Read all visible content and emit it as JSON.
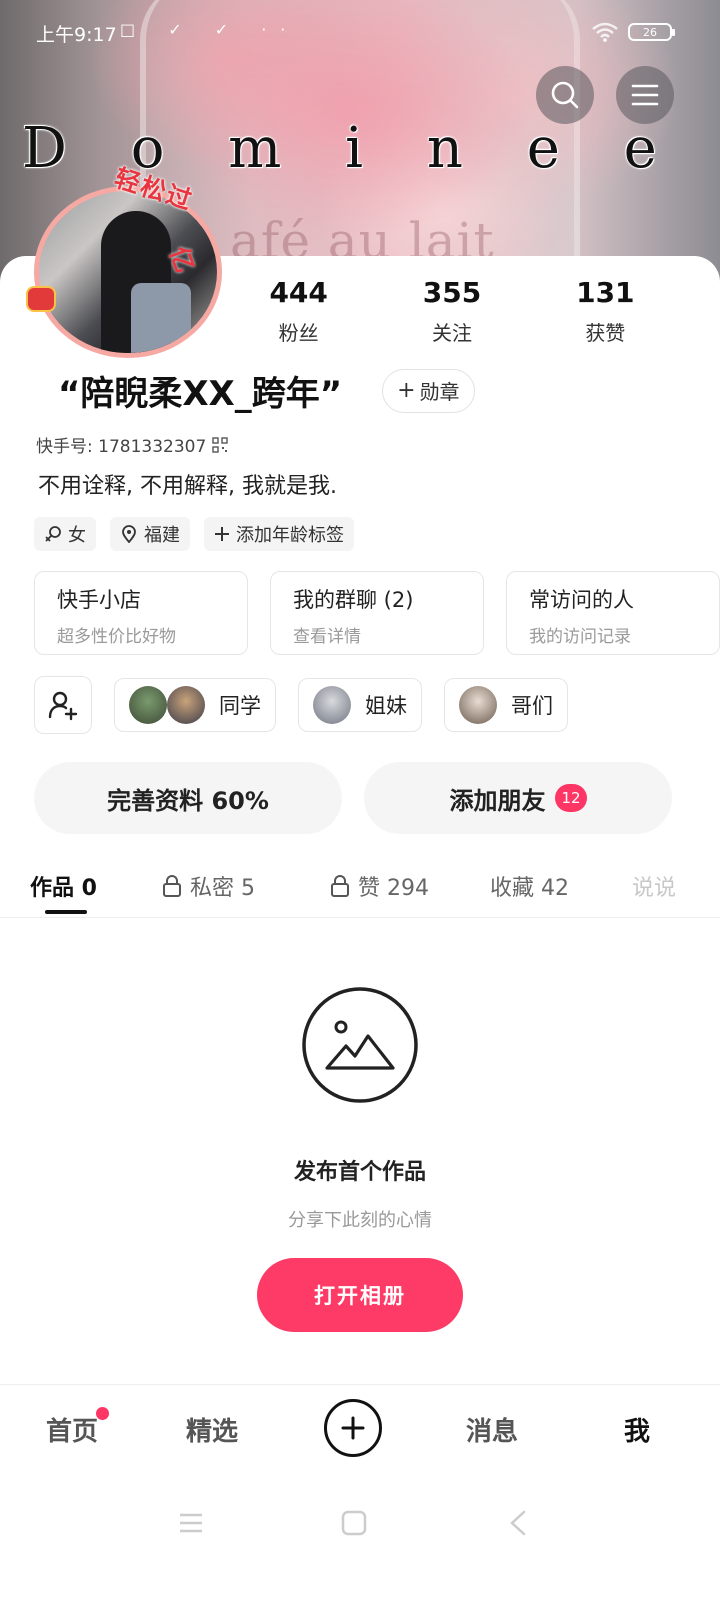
{
  "status_bar": {
    "time": "上午9:17",
    "notification_icons": "□ ✓ ✓ ··",
    "battery": "26"
  },
  "cover": {
    "title": "D o m i n e e r i n g",
    "watermark": "afé au lait"
  },
  "avatar": {
    "badge_text": "轻松过",
    "badge_text2": "亿"
  },
  "stats": [
    {
      "value": "444",
      "label": "粉丝"
    },
    {
      "value": "355",
      "label": "关注"
    },
    {
      "value": "131",
      "label": "获赞"
    }
  ],
  "profile": {
    "name": "“陪睨柔XX_跨年”",
    "medal_label": "勋章",
    "id_label": "快手号: 1781332307",
    "bio": "不用诠释, 不用解释, 我就是我."
  },
  "tags": [
    {
      "icon": "female-icon",
      "label": "女"
    },
    {
      "icon": "location-icon",
      "label": "福建"
    },
    {
      "icon": "plus-icon",
      "label": "添加年龄标签"
    }
  ],
  "boxes": [
    {
      "title": "快手小店",
      "sub": "超多性价比好物"
    },
    {
      "title": "我的群聊 (2)",
      "sub": "查看详情"
    },
    {
      "title": "常访问的人",
      "sub": "我的访问记录"
    }
  ],
  "groups": [
    {
      "label": "同学"
    },
    {
      "label": "姐妹"
    },
    {
      "label": "哥们"
    }
  ],
  "actions": {
    "complete_profile": "完善资料 60%",
    "add_friends": "添加朋友",
    "add_friends_badge": "12"
  },
  "tabs": [
    {
      "label": "作品 0",
      "locked": false,
      "active": true
    },
    {
      "label": "私密 5",
      "locked": true,
      "active": false
    },
    {
      "label": "赞 294",
      "locked": true,
      "active": false
    },
    {
      "label": "收藏 42",
      "locked": false,
      "active": false
    },
    {
      "label": "说说",
      "locked": false,
      "active": false
    }
  ],
  "empty_state": {
    "title": "发布首个作品",
    "subtitle": "分享下此刻的心情",
    "button": "打开相册"
  },
  "bottom_nav": {
    "home": "首页",
    "featured": "精选",
    "messages": "消息",
    "me": "我"
  },
  "colors": {
    "accent": "#fe3a66",
    "text": "#222222",
    "muted": "#999999"
  }
}
